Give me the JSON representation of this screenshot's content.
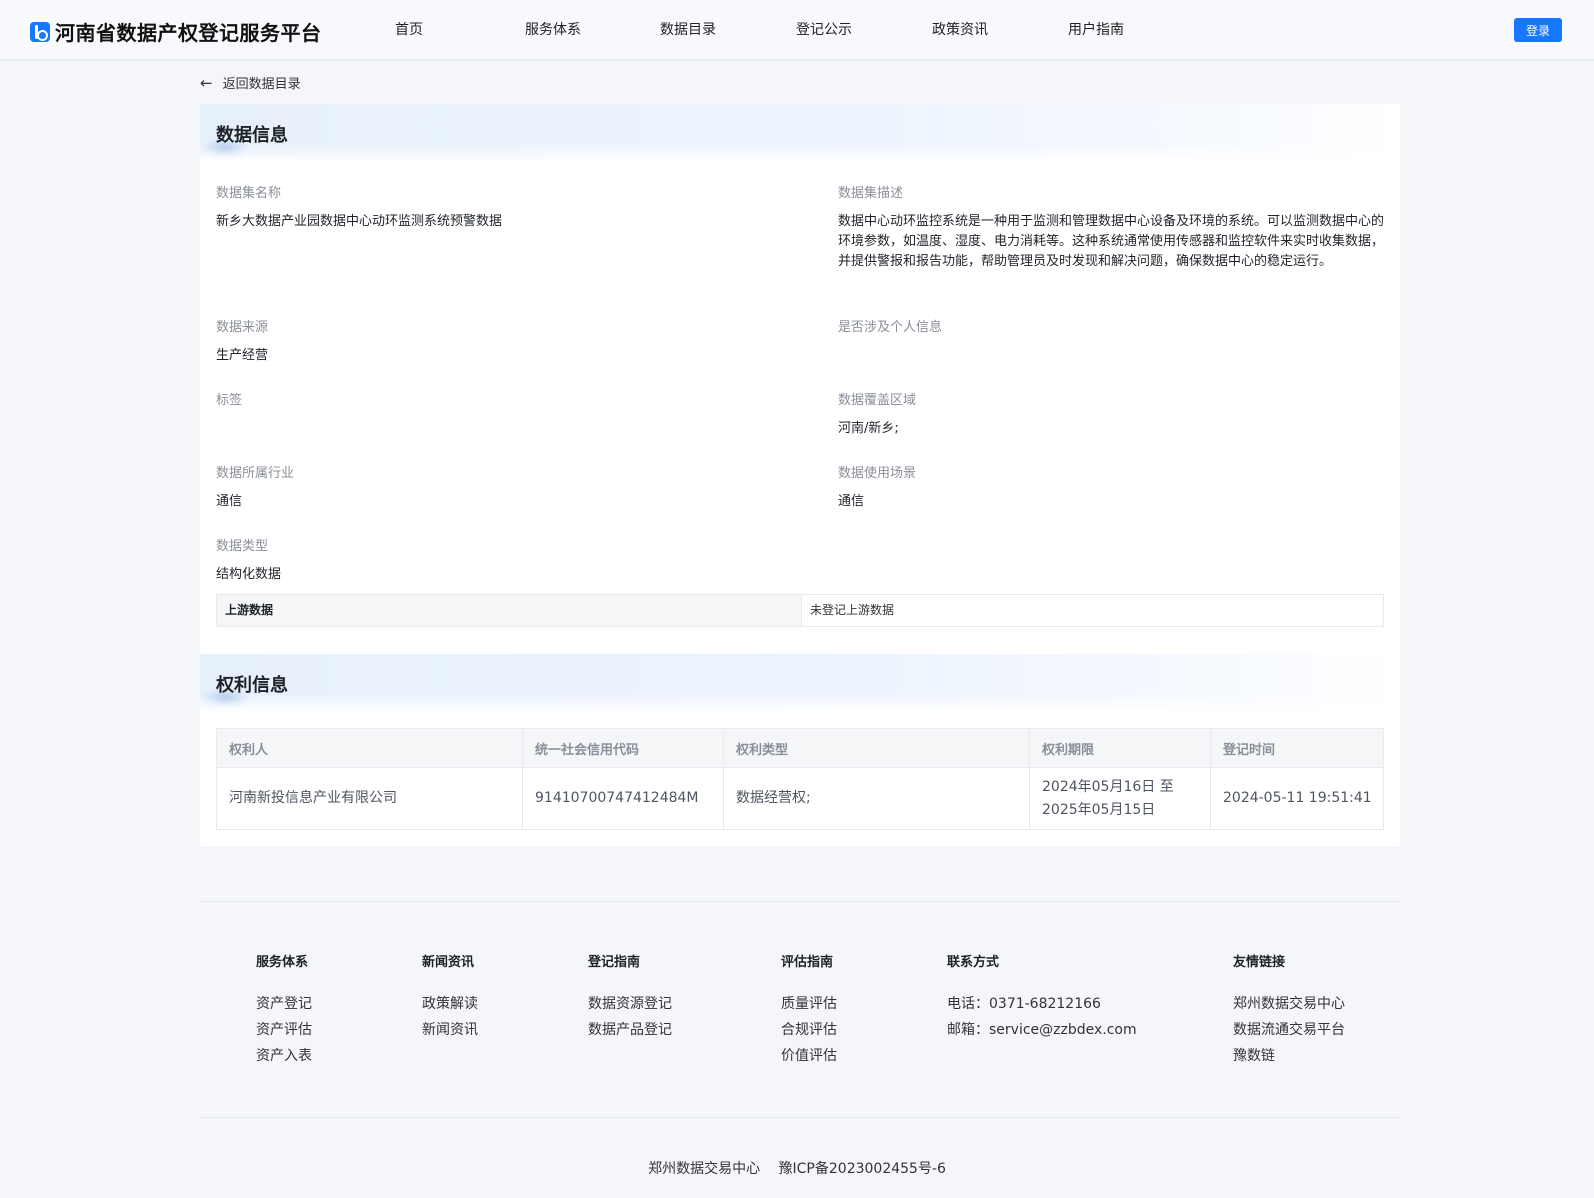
{
  "header": {
    "title": "河南省数据产权登记服务平台",
    "nav": [
      "首页",
      "服务体系",
      "数据目录",
      "登记公示",
      "政策资讯",
      "用户指南"
    ],
    "login_label": "登录"
  },
  "back_label": "返回数据目录",
  "data_info": {
    "section_title": "数据信息",
    "fields": {
      "name_label": "数据集名称",
      "name_value": "新乡大数据产业园数据中心动环监测系统预警数据",
      "desc_label": "数据集描述",
      "desc_value": "数据中心动环监控系统是一种用于监测和管理数据中心设备及环境的系统。可以监测数据中心的环境参数，如温度、湿度、电力消耗等。这种系统通常使用传感器和监控软件来实时收集数据，并提供警报和报告功能，帮助管理员及时发现和解决问题，确保数据中心的稳定运行。",
      "source_label": "数据来源",
      "source_value": "生产经营",
      "personal_label": "是否涉及个人信息",
      "personal_value": "",
      "tags_label": "标签",
      "tags_value": "",
      "region_label": "数据覆盖区域",
      "region_value": "河南/新乡;",
      "industry_label": "数据所属行业",
      "industry_value": "通信",
      "scenario_label": "数据使用场景",
      "scenario_value": "通信",
      "type_label": "数据类型",
      "type_value": "结构化数据"
    },
    "upstream_label": "上游数据",
    "upstream_value": "未登记上游数据"
  },
  "rights_info": {
    "section_title": "权利信息",
    "columns": [
      "权利人",
      "统一社会信用代码",
      "权利类型",
      "权利期限",
      "登记时间"
    ],
    "rows": [
      [
        "河南新投信息产业有限公司",
        "91410700747412484M",
        "数据经营权;",
        "2024年05月16日 至 2025年05月15日",
        "2024-05-11 19:51:41"
      ]
    ]
  },
  "footer": {
    "columns": [
      {
        "title": "服务体系",
        "links": [
          "资产登记",
          "资产评估",
          "资产入表"
        ]
      },
      {
        "title": "新闻资讯",
        "links": [
          "政策解读",
          "新闻资讯"
        ]
      },
      {
        "title": "登记指南",
        "links": [
          "数据资源登记",
          "数据产品登记"
        ]
      },
      {
        "title": "评估指南",
        "links": [
          "质量评估",
          "合规评估",
          "价值评估"
        ]
      },
      {
        "title": "联系方式",
        "links": [
          "电话：0371-68212166",
          "邮箱：service@zzbdex.com"
        ]
      },
      {
        "title": "友情链接",
        "links": [
          "郑州数据交易中心",
          "数据流通交易平台",
          "豫数链"
        ]
      }
    ],
    "copyright_org": "郑州数据交易中心",
    "copyright_icp": "豫ICP备2023002455号-6"
  }
}
